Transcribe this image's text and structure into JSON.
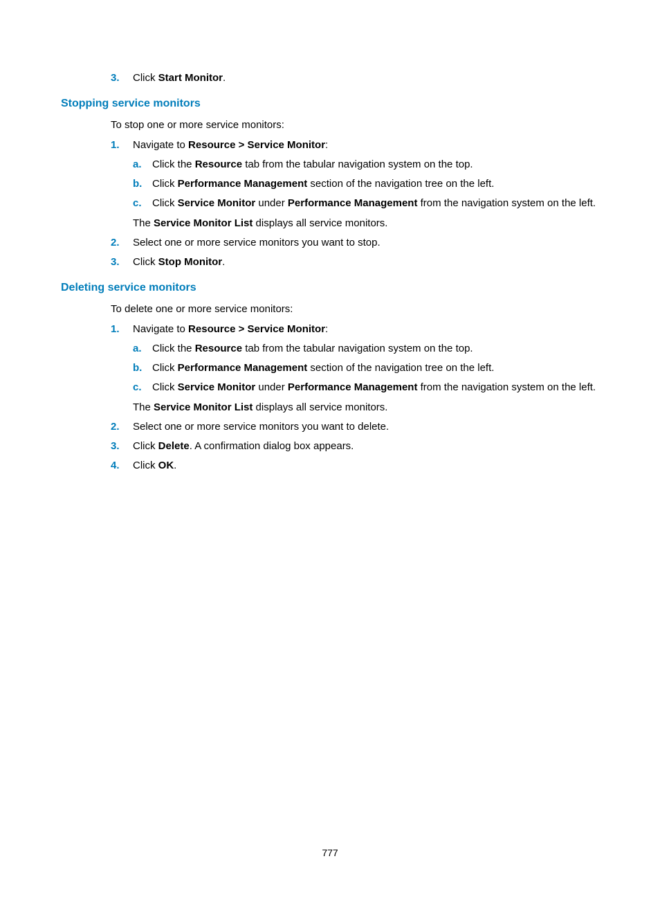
{
  "pageNumber": "777",
  "top": {
    "marker": "3.",
    "pre": "Click ",
    "bold": "Start Monitor",
    "post": "."
  },
  "stopping": {
    "heading": "Stopping service monitors",
    "intro": "To stop one or more service monitors:",
    "s1": {
      "marker": "1.",
      "pre": "Navigate to ",
      "bold": "Resource > Service Monitor",
      "post": ":",
      "a": {
        "marker": "a.",
        "pre": "Click the ",
        "bold": "Resource",
        "post": " tab from the tabular navigation system on the top."
      },
      "b": {
        "marker": "b.",
        "pre": "Click ",
        "bold": "Performance Management",
        "post": " section of the navigation tree on the left."
      },
      "c": {
        "marker": "c.",
        "pre": "Click ",
        "bold1": "Service Monitor",
        "mid": " under ",
        "bold2": "Performance Management",
        "post": " from the navigation system on the left."
      },
      "result": {
        "pre": "The ",
        "bold": "Service Monitor List",
        "post": " displays all service monitors."
      }
    },
    "s2": {
      "marker": "2.",
      "text": "Select one or more service monitors you want to stop."
    },
    "s3": {
      "marker": "3.",
      "pre": "Click ",
      "bold": "Stop Monitor",
      "post": "."
    }
  },
  "deleting": {
    "heading": "Deleting service monitors",
    "intro": "To delete one or more service monitors:",
    "s1": {
      "marker": "1.",
      "pre": "Navigate to ",
      "bold": "Resource > Service Monitor",
      "post": ":",
      "a": {
        "marker": "a.",
        "pre": "Click the ",
        "bold": "Resource",
        "post": " tab from the tabular navigation system on the top."
      },
      "b": {
        "marker": "b.",
        "pre": "Click ",
        "bold": "Performance Management",
        "post": " section of the navigation tree on the left."
      },
      "c": {
        "marker": "c.",
        "pre": "Click ",
        "bold1": "Service Monitor",
        "mid": " under ",
        "bold2": "Performance Management",
        "post": " from the navigation system on the left."
      },
      "result": {
        "pre": "The ",
        "bold": "Service Monitor List",
        "post": " displays all service monitors."
      }
    },
    "s2": {
      "marker": "2.",
      "text": "Select one or more service monitors you want to delete."
    },
    "s3": {
      "marker": "3.",
      "pre": "Click ",
      "bold": "Delete",
      "post": ". A confirmation dialog box appears."
    },
    "s4": {
      "marker": "4.",
      "pre": "Click ",
      "bold": "OK",
      "post": "."
    }
  }
}
